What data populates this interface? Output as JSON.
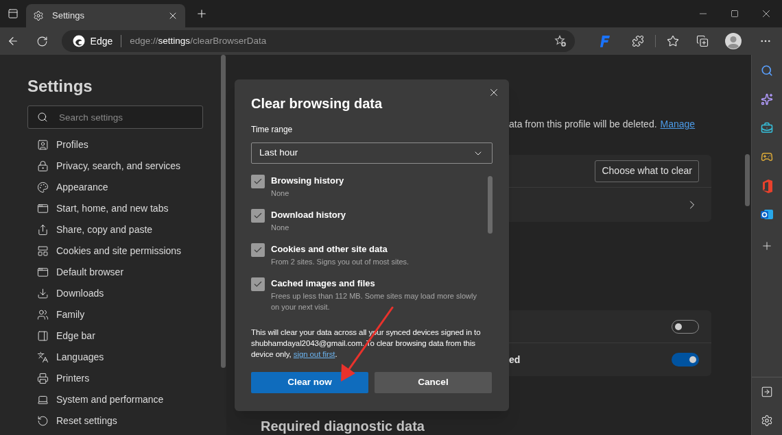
{
  "browser": {
    "tab": {
      "title": "Settings"
    },
    "address": {
      "site_label": "Edge",
      "url_scheme": "edge://",
      "url_host": "settings",
      "url_path": "/clearBrowserData"
    }
  },
  "nav": {
    "title": "Settings",
    "search": {
      "placeholder": "Search settings"
    },
    "items": [
      {
        "label": "Profiles"
      },
      {
        "label": "Privacy, search, and services"
      },
      {
        "label": "Appearance"
      },
      {
        "label": "Start, home, and new tabs"
      },
      {
        "label": "Share, copy and paste"
      },
      {
        "label": "Cookies and site permissions"
      },
      {
        "label": "Default browser"
      },
      {
        "label": "Downloads"
      },
      {
        "label": "Family"
      },
      {
        "label": "Edge bar"
      },
      {
        "label": "Languages"
      },
      {
        "label": "Printers"
      },
      {
        "label": "System and performance"
      },
      {
        "label": "Reset settings"
      }
    ]
  },
  "content": {
    "notice": {
      "text": "ata from this profile will be deleted.",
      "link": "Manage"
    },
    "clear_card": {
      "button": "Choose what to clear"
    },
    "toggle_rows": [
      {
        "on": false
      },
      {
        "label": "ed",
        "on": true
      }
    ],
    "heading": "Required diagnostic data"
  },
  "dialog": {
    "title": "Clear browsing data",
    "time_range": {
      "label": "Time range",
      "value": "Last hour"
    },
    "options": [
      {
        "label": "Browsing history",
        "detail": "None",
        "checked": true
      },
      {
        "label": "Download history",
        "detail": "None",
        "checked": true
      },
      {
        "label": "Cookies and other site data",
        "detail": "From 2 sites. Signs you out of most sites.",
        "checked": true
      },
      {
        "label": "Cached images and files",
        "detail": "Frees up less than 112 MB. Some sites may load more slowly on your next visit.",
        "checked": true
      }
    ],
    "note": {
      "text": "This will clear your data across all your synced devices signed in to shubhamdayal2043@gmail.com. To clear browsing data from this device only, ",
      "link": "sign out first",
      "end": "."
    },
    "buttons": [
      {
        "label": "Clear now",
        "kind": "primary"
      },
      {
        "label": "Cancel",
        "kind": "secondary"
      }
    ]
  }
}
